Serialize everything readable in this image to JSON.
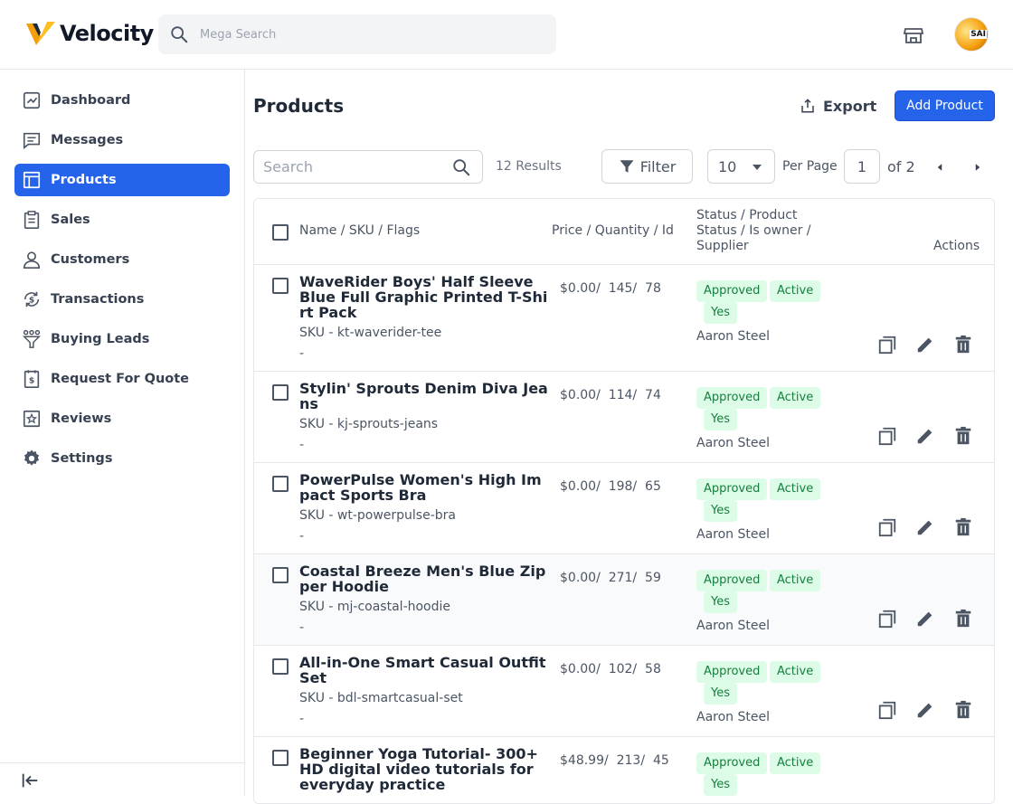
{
  "header": {
    "brand": "Velocity",
    "search_placeholder": "Mega Search",
    "avatar_text": "SAI"
  },
  "sidebar": {
    "items": [
      {
        "label": "Dashboard",
        "icon": "dashboard-icon"
      },
      {
        "label": "Messages",
        "icon": "messages-icon"
      },
      {
        "label": "Products",
        "icon": "products-icon",
        "active": true
      },
      {
        "label": "Sales",
        "icon": "sales-icon"
      },
      {
        "label": "Customers",
        "icon": "customers-icon"
      },
      {
        "label": "Transactions",
        "icon": "transactions-icon"
      },
      {
        "label": "Buying Leads",
        "icon": "buying-leads-icon"
      },
      {
        "label": "Request For Quote",
        "icon": "quote-icon"
      },
      {
        "label": "Reviews",
        "icon": "reviews-icon"
      },
      {
        "label": "Settings",
        "icon": "settings-icon"
      }
    ]
  },
  "page": {
    "title": "Products",
    "export_label": "Export",
    "add_label": "Add Product"
  },
  "toolbar": {
    "search_placeholder": "Search",
    "results": "12 Results",
    "filter_label": "Filter",
    "per_page_value": "10",
    "per_page_label": "Per Page",
    "page_value": "1",
    "of_pages": "of 2"
  },
  "table": {
    "headers": {
      "name": "Name / SKU / Flags",
      "price": "Price / Quantity / Id",
      "status": "Status / Product Status / Is owner / Supplier",
      "actions": "Actions"
    },
    "rows": [
      {
        "name": "WaveRider Boys' Half Sleeve Blue Full Graphic Printed T-Shirt Pack",
        "sku": "SKU - kt-waverider-tee",
        "flags": "-",
        "price": "$0.00/  145/  78",
        "status": "Approved",
        "product_status": "Active",
        "is_owner": "Yes",
        "supplier": "Aaron Steel"
      },
      {
        "name": "Stylin' Sprouts Denim Diva Jeans",
        "sku": "SKU - kj-sprouts-jeans",
        "flags": "-",
        "price": "$0.00/  114/  74",
        "status": "Approved",
        "product_status": "Active",
        "is_owner": "Yes",
        "supplier": "Aaron Steel"
      },
      {
        "name": "PowerPulse Women's High Impact Sports Bra",
        "sku": "SKU - wt-powerpulse-bra",
        "flags": "-",
        "price": "$0.00/  198/  65",
        "status": "Approved",
        "product_status": "Active",
        "is_owner": "Yes",
        "supplier": "Aaron Steel"
      },
      {
        "name": "Coastal Breeze Men's Blue Zipper Hoodie",
        "sku": "SKU - mj-coastal-hoodie",
        "flags": "-",
        "price": "$0.00/  271/  59",
        "status": "Approved",
        "product_status": "Active",
        "is_owner": "Yes",
        "supplier": "Aaron Steel"
      },
      {
        "name": "All-in-One Smart Casual Outfit Set",
        "sku": "SKU - bdl-smartcasual-set",
        "flags": "-",
        "price": "$0.00/  102/  58",
        "status": "Approved",
        "product_status": "Active",
        "is_owner": "Yes",
        "supplier": "Aaron Steel"
      },
      {
        "name": "Beginner Yoga Tutorial- 300+ HD digital video tutorials for everyday practice",
        "sku": "",
        "flags": "",
        "price": "$48.99/  213/  45",
        "status": "Approved",
        "product_status": "Active",
        "is_owner": "Yes",
        "supplier": ""
      }
    ]
  },
  "colors": {
    "primary": "#2563eb",
    "badge_bg": "#dcfce7",
    "badge_text": "#15803d",
    "logo_orange": "#f59e0b"
  }
}
